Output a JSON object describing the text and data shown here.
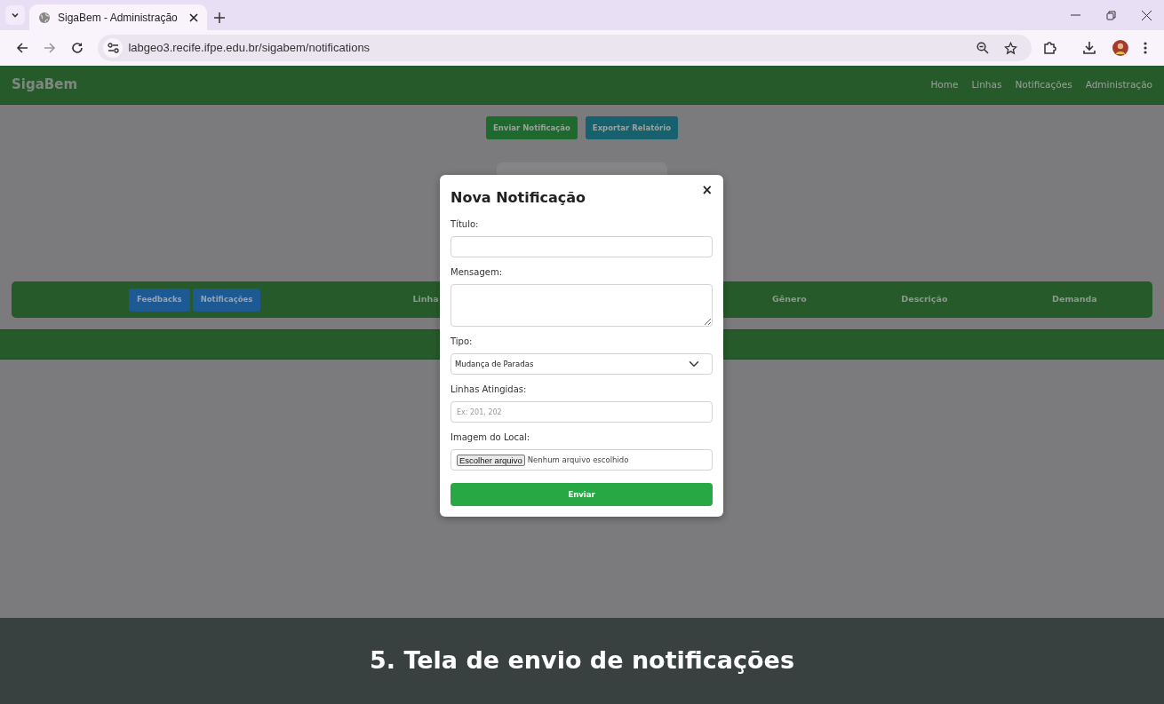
{
  "browser": {
    "tab_title": "SigaBem - Administração",
    "url": "labgeo3.recife.ifpe.edu.br/sigabem/notifications"
  },
  "navbar": {
    "brand": "SigaBem",
    "links": [
      {
        "label": "Home"
      },
      {
        "label": "Linhas"
      },
      {
        "label": "Notificações"
      },
      {
        "label": "Administração"
      }
    ]
  },
  "actions": [
    {
      "label": "Enviar Notificação",
      "kind": "send"
    },
    {
      "label": "Exportar Relatório",
      "kind": "export"
    }
  ],
  "table": {
    "tabs": [
      {
        "label": "Feedbacks"
      },
      {
        "label": "Notificações"
      }
    ],
    "columns": [
      "Linha",
      "Gênero",
      "Descrição",
      "Demanda"
    ]
  },
  "modal": {
    "title": "Nova Notificação",
    "close": "×",
    "fields": [
      {
        "label": "Título:",
        "kind": "text"
      },
      {
        "label": "Mensagem:",
        "kind": "textarea"
      },
      {
        "label": "Tipo:",
        "kind": "select",
        "value": "Mudança de Paradas"
      },
      {
        "label": "Linhas Atingidas:",
        "kind": "text",
        "placeholder": "Ex: 201, 202"
      },
      {
        "label": "Imagem do Local:",
        "kind": "file",
        "button": "Escolher arquivo",
        "status": "Nenhum arquivo escolhido"
      }
    ],
    "submit": "Enviar"
  },
  "caption": "5. Tela de envio de notificações"
}
